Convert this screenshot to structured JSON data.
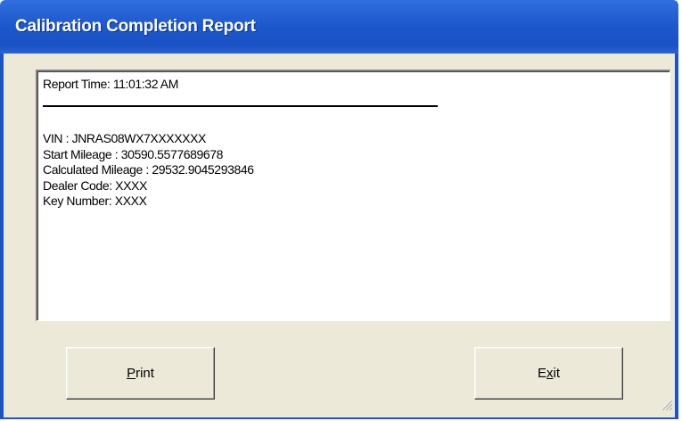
{
  "window": {
    "title": "Calibration Completion Report"
  },
  "report": {
    "time_line": "Report Time: 11:01:32 AM",
    "lines": [
      "VIN : JNRAS08WX7XXXXXXX",
      "Start Mileage : 30590.5577689678",
      "Calculated Mileage : 29532.9045293846",
      "Dealer Code: XXXX",
      "Key Number: XXXX"
    ]
  },
  "buttons": {
    "print": {
      "prefix": "",
      "mnemonic": "P",
      "suffix": "rint"
    },
    "exit": {
      "prefix": "E",
      "mnemonic": "x",
      "suffix": "it"
    }
  },
  "colors": {
    "titlebar": "#1d57cc",
    "client_bg": "#ece9d8",
    "report_bg": "#ffffff"
  }
}
